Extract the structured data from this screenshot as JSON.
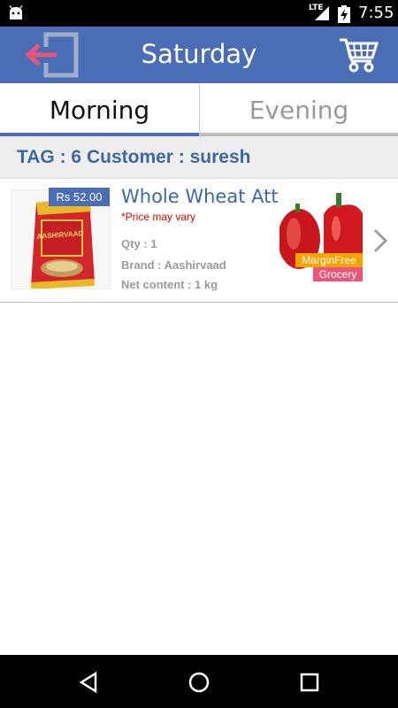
{
  "status_bar": {
    "network": "LTE",
    "time": "7:55"
  },
  "app_bar": {
    "title": "Saturday"
  },
  "tabs": [
    {
      "label": "Morning",
      "active": true
    },
    {
      "label": "Evening",
      "active": false
    }
  ],
  "tag_bar": {
    "text": "TAG : 6 Customer : suresh"
  },
  "product": {
    "price": "Rs 52.00",
    "name": "Whole Wheat Atta",
    "price_note": "*Price may vary",
    "qty": "Qty : 1",
    "brand": "Brand : Aashirvaad",
    "net_content": "Net content : 1 kg",
    "package_brand_text": "AASHIRVAAD"
  },
  "ad_banner": {
    "line1": "MarginFree",
    "line2": "Grocery"
  },
  "colors": {
    "primary": "#4a6eb5",
    "accent_pink": "#e8577b",
    "price_note_red": "#e00000",
    "ad_orange": "#f4a300"
  }
}
